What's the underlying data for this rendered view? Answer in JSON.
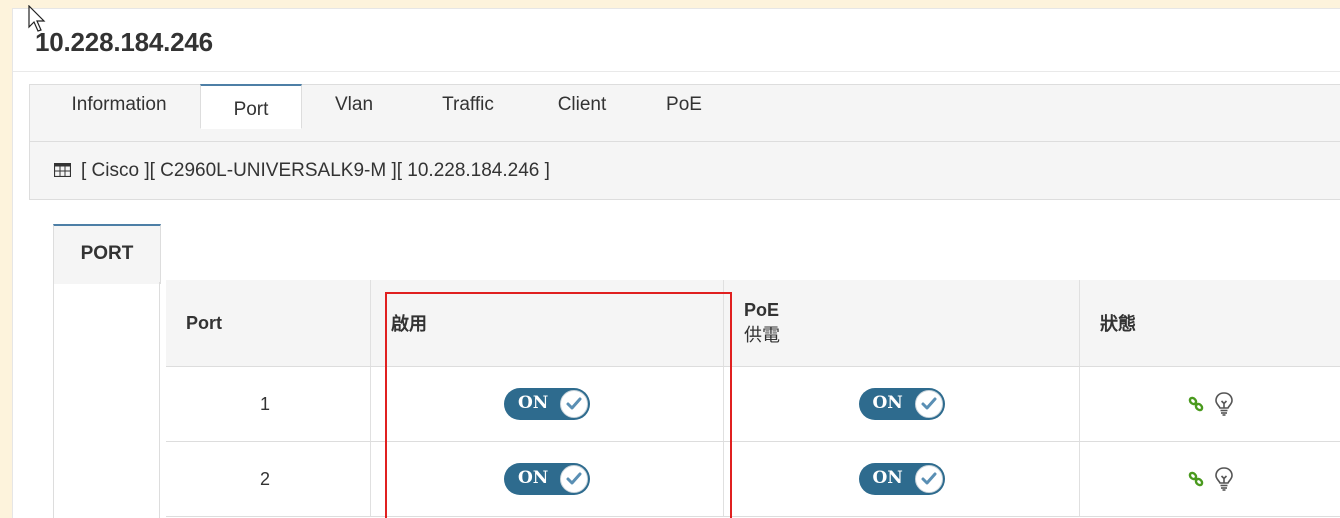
{
  "page": {
    "title": "10.228.184.246"
  },
  "tabs": [
    {
      "label": "Information",
      "active": false
    },
    {
      "label": "Port",
      "active": true
    },
    {
      "label": "Vlan",
      "active": false
    },
    {
      "label": "Traffic",
      "active": false
    },
    {
      "label": "Client",
      "active": false
    },
    {
      "label": "PoE",
      "active": false
    }
  ],
  "toolbar": {
    "icon": "table-grid-icon",
    "text": "[ Cisco ][ C2960L-UNIVERSALK9-M ][ 10.228.184.246 ]"
  },
  "inner_tab": {
    "label": "PORT"
  },
  "table": {
    "headers": {
      "port": "Port",
      "enable": "啟用",
      "poe_line1": "PoE",
      "poe_line2": "供電",
      "status": "狀態"
    },
    "rows": [
      {
        "port": "1",
        "enable": "ON",
        "poe": "ON",
        "status_icons": [
          "link-icon",
          "lightbulb-icon"
        ]
      },
      {
        "port": "2",
        "enable": "ON",
        "poe": "ON",
        "status_icons": [
          "link-icon",
          "lightbulb-icon"
        ]
      }
    ]
  },
  "colors": {
    "toggle": "#2e6b8e",
    "highlight": "#e02020",
    "link_icon": "#4a9a1e",
    "tab_accent": "#4d7fa6"
  }
}
